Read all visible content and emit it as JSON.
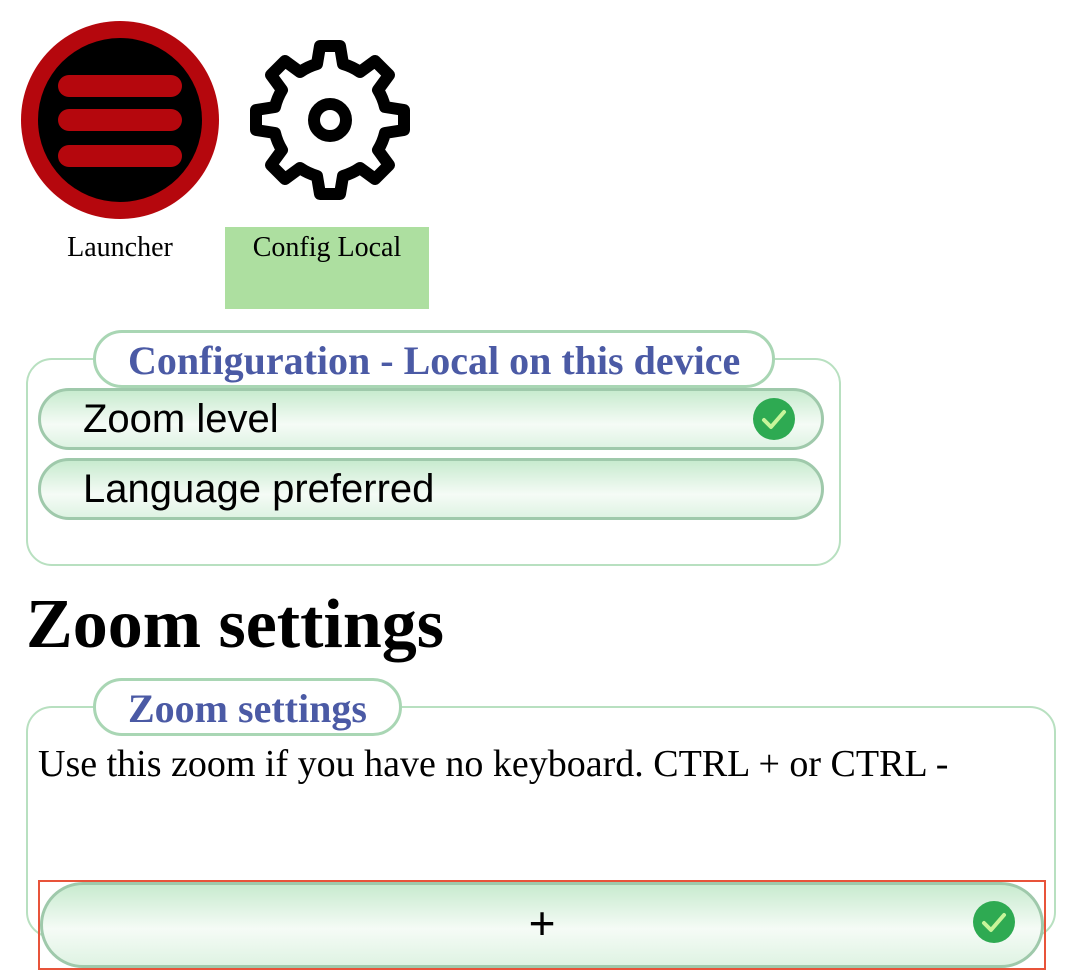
{
  "apps": [
    {
      "label": "Launcher",
      "icon": "launcher-menu-icon"
    },
    {
      "label": "Config Local",
      "icon": "gear-icon",
      "selected": true
    }
  ],
  "config_panel": {
    "legend": "Configuration - Local on this device",
    "items": [
      {
        "label": "Zoom level",
        "checked": true
      },
      {
        "label": "Language preferred",
        "checked": false
      }
    ]
  },
  "heading": "Zoom settings",
  "zoom_panel": {
    "legend": "Zoom settings",
    "help_text": "Use this zoom if you have no keyboard. CTRL + or CTRL -",
    "plus_label": "+",
    "plus_checked": true
  },
  "colors": {
    "launcher_red": "#b5070d",
    "selected_tab": "#addfa0",
    "legend_text": "#4b5aa5",
    "check_green": "#2eaa52",
    "focus_border": "#e8533a"
  }
}
